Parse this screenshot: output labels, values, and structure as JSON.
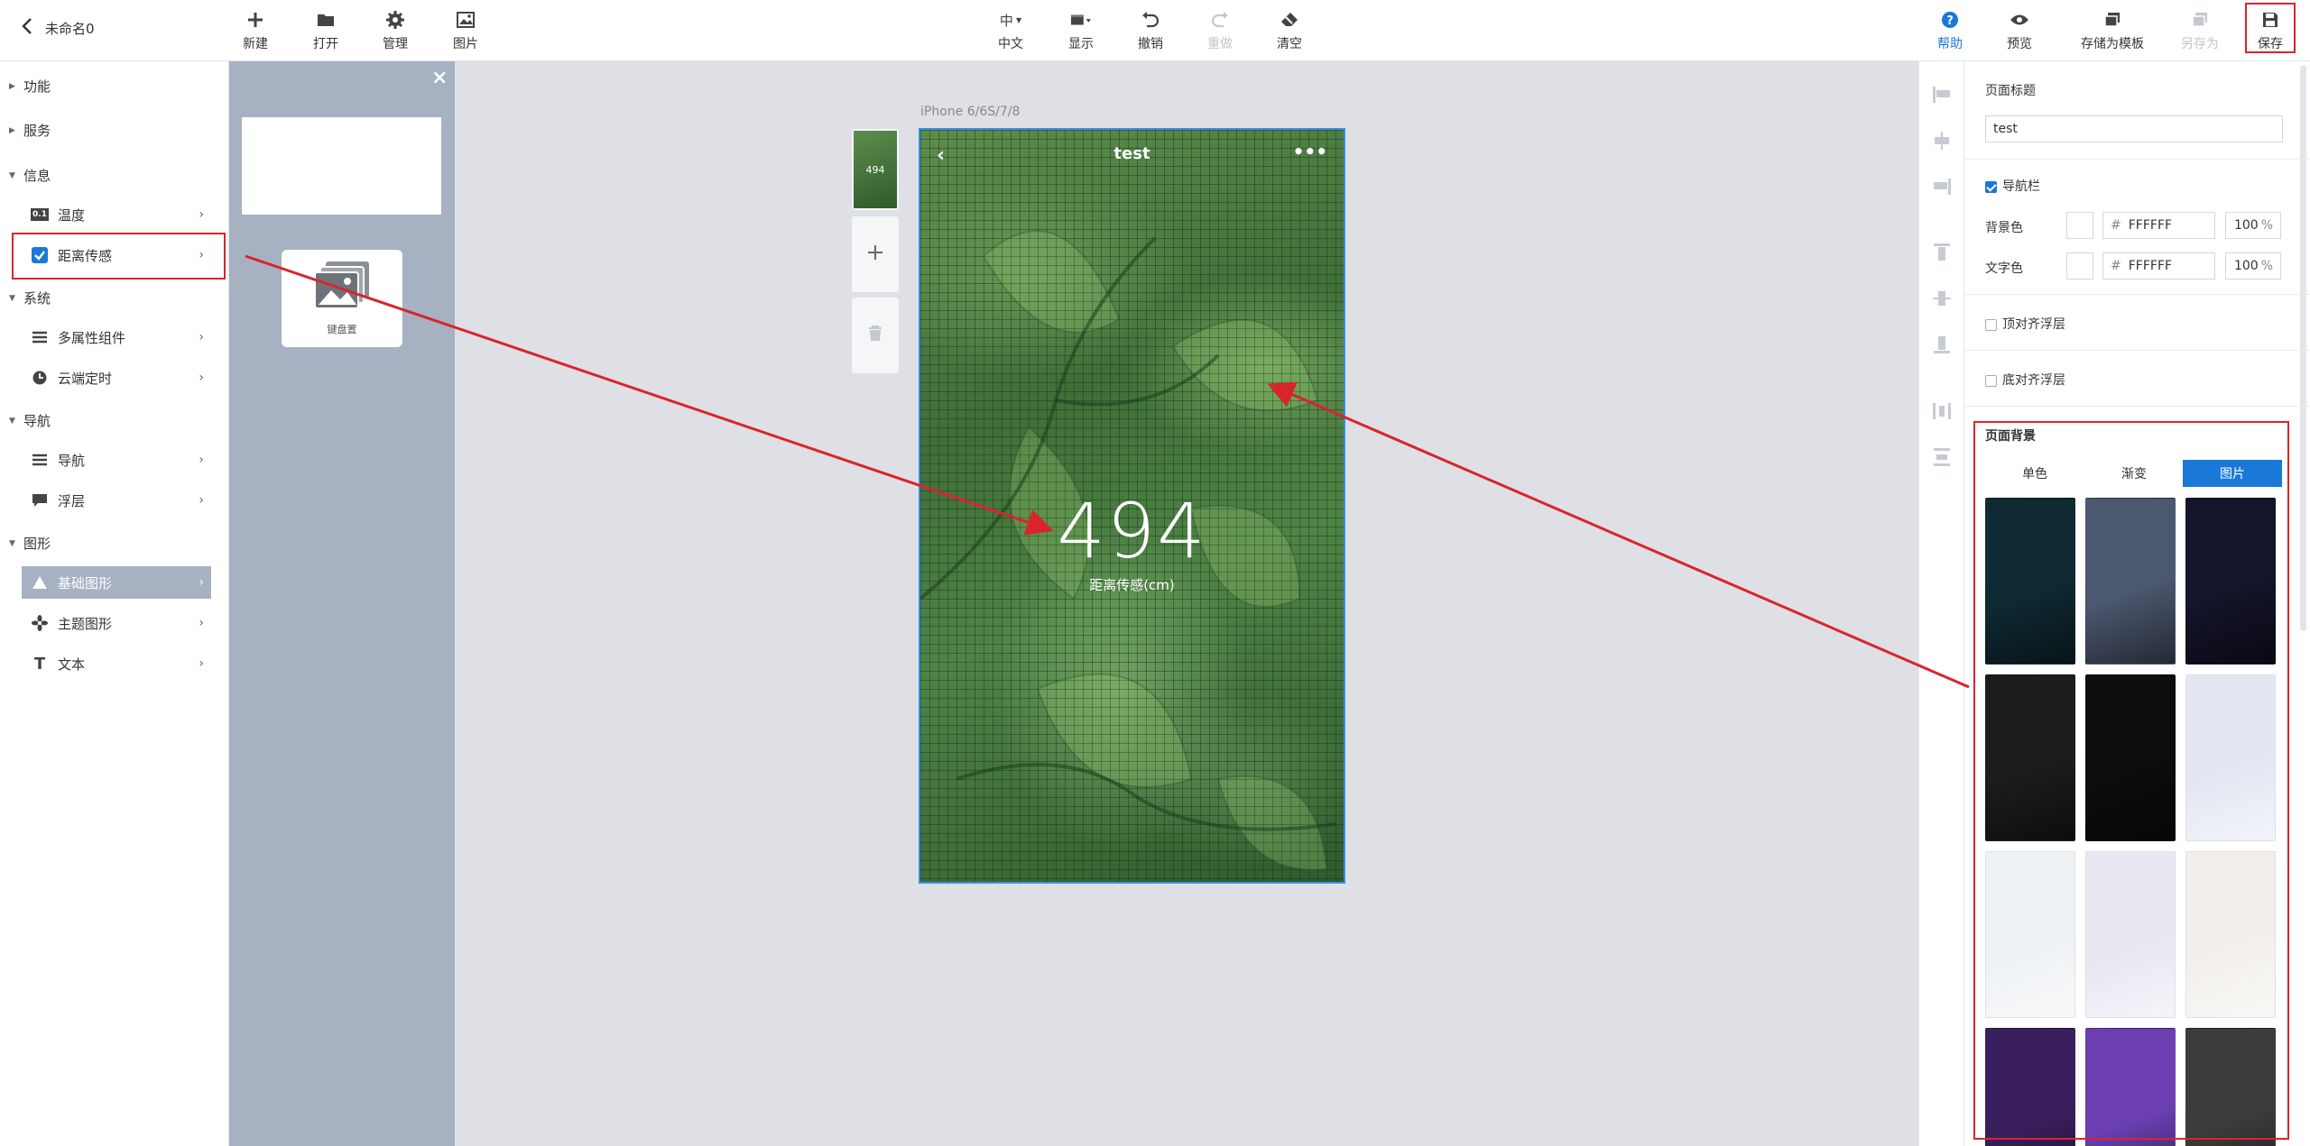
{
  "app": {
    "doc_title": "未命名0"
  },
  "toolbar": {
    "left": [
      {
        "label": "新建",
        "icon": "plus-icon"
      },
      {
        "label": "打开",
        "icon": "folder-icon"
      },
      {
        "label": "管理",
        "icon": "gear-icon"
      },
      {
        "label": "图片",
        "icon": "image-icon"
      }
    ],
    "center": [
      {
        "label": "中文",
        "icon": "language-icon"
      },
      {
        "label": "显示",
        "icon": "display-icon"
      },
      {
        "label": "撤销",
        "icon": "undo-icon"
      },
      {
        "label": "重做",
        "icon": "redo-icon"
      },
      {
        "label": "清空",
        "icon": "eraser-icon"
      }
    ],
    "center_icon_glyph": "中",
    "right": [
      {
        "label": "帮助",
        "icon": "help-icon"
      },
      {
        "label": "预览",
        "icon": "eye-icon"
      },
      {
        "label": "存储为模板",
        "icon": "template-icon"
      },
      {
        "label": "另存为",
        "icon": "save-as-icon"
      },
      {
        "label": "保存",
        "icon": "save-icon"
      }
    ]
  },
  "sidebar": {
    "sections": [
      {
        "label": "功能"
      },
      {
        "label": "服务"
      },
      {
        "label": "信息"
      },
      {
        "label": "系统"
      },
      {
        "label": "导航"
      },
      {
        "label": "图形"
      }
    ],
    "items": [
      {
        "label": "温度",
        "icon": "temperature-icon",
        "glyph": "0.1"
      },
      {
        "label": "距离传感",
        "icon": "checkbox-icon"
      },
      {
        "label": "多属性组件",
        "icon": "list-icon"
      },
      {
        "label": "云端定时",
        "icon": "clock-icon"
      },
      {
        "label": "导航",
        "icon": "list-icon"
      },
      {
        "label": "浮层",
        "icon": "layer-icon"
      },
      {
        "label": "基础图形",
        "icon": "triangle-icon"
      },
      {
        "label": "主题图形",
        "icon": "flower-icon"
      },
      {
        "label": "文本",
        "icon": "text-icon",
        "glyph": "T"
      }
    ]
  },
  "component_panel": {
    "tile_label": "键盘置"
  },
  "canvas": {
    "device_label": "iPhone 6/6S/7/8",
    "thumb_value": "494",
    "page": {
      "title": "test",
      "value": "494",
      "value_label": "距离传感(cm)"
    }
  },
  "right_panel": {
    "page_title_label": "页面标题",
    "page_title_value": "test",
    "navbar_label": "导航栏",
    "bg_color_label": "背景色",
    "bg_color_hex": "FFFFFF",
    "bg_color_opacity": "100",
    "text_color_label": "文字色",
    "text_color_hex": "FFFFFF",
    "text_color_opacity": "100",
    "hash": "#",
    "percent": "%",
    "top_float_label": "顶对齐浮层",
    "bottom_float_label": "底对齐浮层",
    "page_bg_label": "页面背景",
    "bg_tabs": [
      "单色",
      "渐变",
      "图片"
    ],
    "bg_thumbnails": [
      {
        "name": "dark-teal-texture",
        "color": "#0f2a33"
      },
      {
        "name": "slate-bokeh",
        "color": "#4c5870"
      },
      {
        "name": "dark-navy-stripes",
        "color": "#14142a"
      },
      {
        "name": "dark-hexagon",
        "color": "#1c1c1c"
      },
      {
        "name": "black-dots",
        "color": "#0d0d0d"
      },
      {
        "name": "light-blue-room",
        "color": "#e2e7f2"
      },
      {
        "name": "light-mist",
        "color": "#eef1f4"
      },
      {
        "name": "light-lavender",
        "color": "#e8e7f2"
      },
      {
        "name": "light-beige",
        "color": "#f2efea"
      },
      {
        "name": "purple-crystal",
        "color": "#3a1f5e"
      },
      {
        "name": "blue-purple-gradient",
        "color": "#6b3fb2"
      },
      {
        "name": "gray-silk",
        "color": "#3c3c3c"
      }
    ]
  },
  "colors": {
    "accent": "#1a78d7",
    "highlight_red": "#d9242c",
    "active_item_bg": "#a6b1c2"
  }
}
